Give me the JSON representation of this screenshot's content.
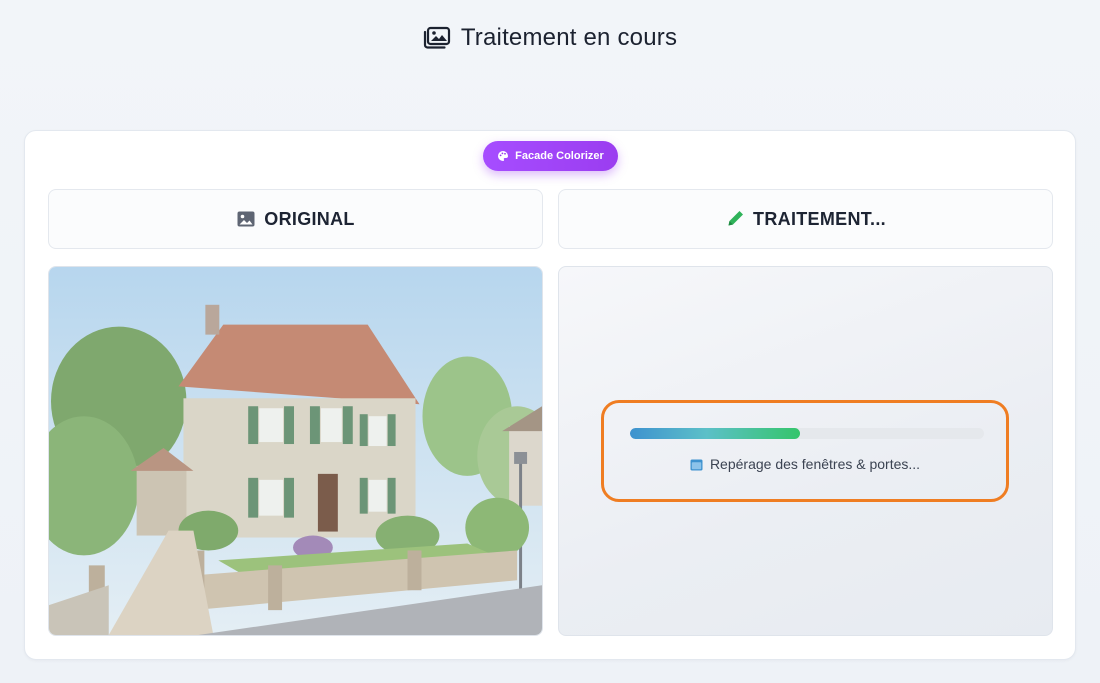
{
  "header": {
    "title": "Traitement en cours",
    "icon": "images-icon"
  },
  "badge": {
    "label": "Facade Colorizer",
    "icon": "palette-icon",
    "color": "#a64dff"
  },
  "columns": {
    "original": {
      "label": "ORIGINAL",
      "icon": "image-icon"
    },
    "processed": {
      "label": "TRAITEMENT...",
      "icon": "pencil-icon",
      "icon_color": "#2fb35a"
    }
  },
  "progress": {
    "fraction": 0.48,
    "status_text": "Repérage des fenêtres & portes...",
    "status_icon": "window-icon",
    "highlight_color": "#ef7d22"
  }
}
